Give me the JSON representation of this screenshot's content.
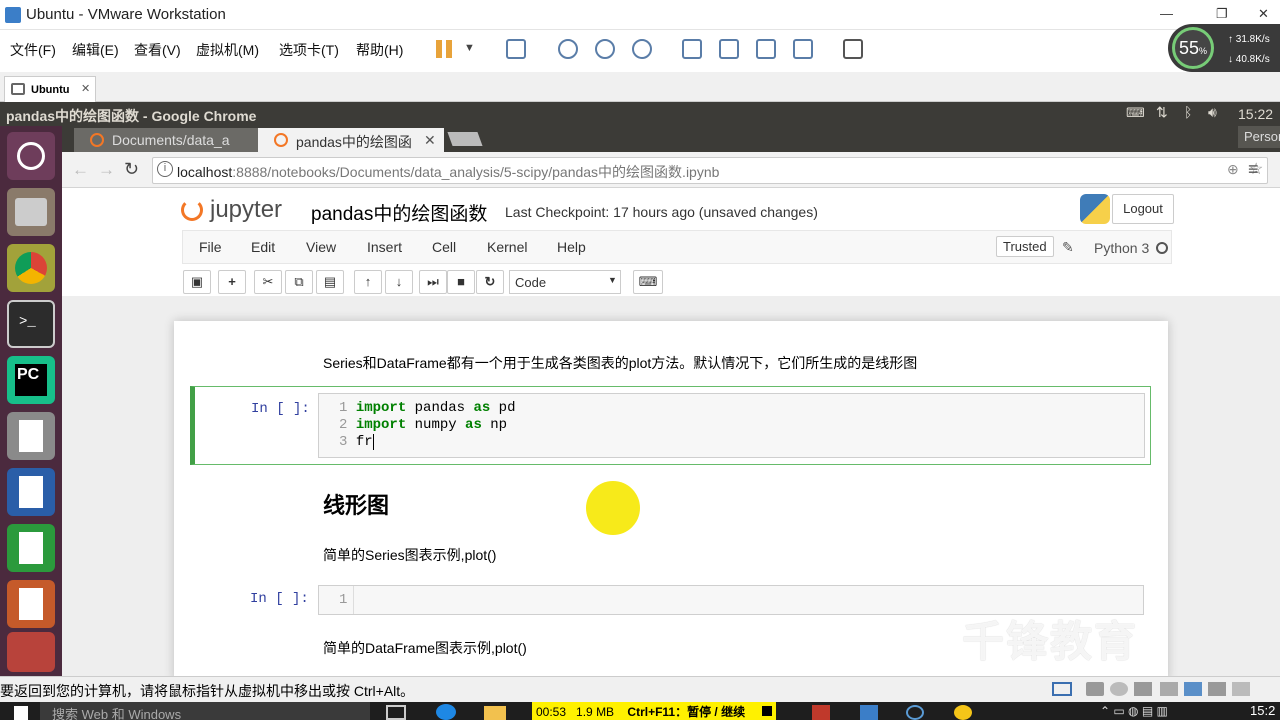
{
  "vmware": {
    "title": "Ubuntu - VMware Workstation",
    "menu": [
      "文件(F)",
      "编辑(E)",
      "查看(V)",
      "虚拟机(M)",
      "选项卡(T)",
      "帮助(H)"
    ],
    "tab": "Ubuntu",
    "status_hint": "要返回到您的计算机，请将鼠标指针从虚拟机中移出或按 Ctrl+Alt。"
  },
  "perf": {
    "cpu": "55",
    "cpu_unit": "%",
    "up": "31.8K/s",
    "down": "40.8K/s"
  },
  "ubuntu": {
    "window_title": "pandas中的绘图函数 - Google Chrome",
    "clock": "15:22"
  },
  "chrome": {
    "tabs": [
      {
        "label": "Documents/data_a"
      },
      {
        "label": "pandas中的绘图函"
      }
    ],
    "person": "Person",
    "url_host": "localhost",
    "url_rest": ":8888/notebooks/Documents/data_analysis/5-scipy/pandas中的绘图函数.ipynb"
  },
  "jupyter": {
    "logo": "jupyter",
    "notebook_name": "pandas中的绘图函数",
    "checkpoint": "Last Checkpoint: 17 hours ago (unsaved changes)",
    "logout": "Logout",
    "menu": [
      "File",
      "Edit",
      "View",
      "Insert",
      "Cell",
      "Kernel",
      "Help"
    ],
    "trusted": "Trusted",
    "kernel": "Python 3",
    "cell_type": "Code"
  },
  "notebook": {
    "md1": "Series和DataFrame都有一个用于生成各类图表的plot方法。默认情况下，它们所生成的是线形图",
    "cell1": {
      "prompt": "In [ ]:",
      "lines": [
        {
          "n": "1",
          "kw": "import",
          "mid": " pandas ",
          "kw2": "as",
          "end": " pd"
        },
        {
          "n": "2",
          "kw": "import",
          "mid": " numpy ",
          "kw2": "as",
          "end": " np"
        },
        {
          "n": "3",
          "kw": "",
          "mid": "fr",
          "kw2": "",
          "end": ""
        }
      ]
    },
    "heading": "线形图",
    "md2": "简单的Series图表示例,plot()",
    "cell2": {
      "prompt": "In [ ]:",
      "n": "1"
    },
    "md3": "简单的DataFrame图表示例,plot()"
  },
  "vm_timer": {
    "time": "00:53",
    "size": "1.9 MB",
    "hint": "Ctrl+F11：暂停 / 继续"
  },
  "taskbar": {
    "search": "搜索 Web 和 Windows",
    "time": "15:2"
  },
  "watermark": "千锋教育"
}
